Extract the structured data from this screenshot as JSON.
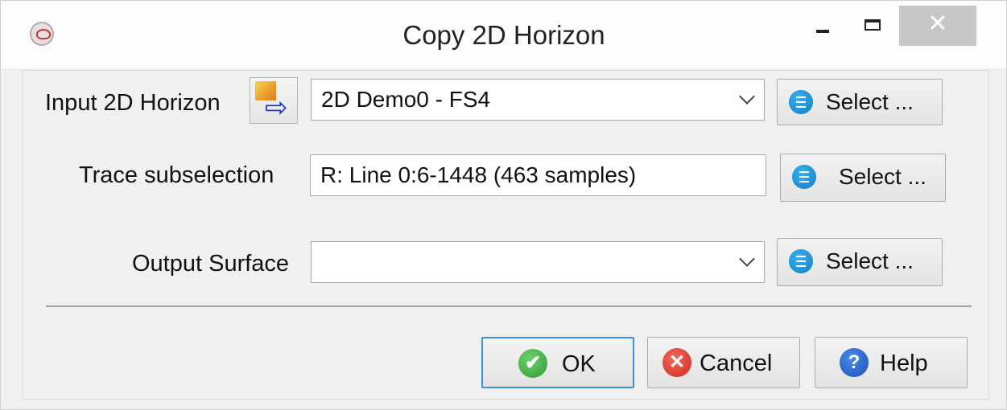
{
  "window": {
    "title": "Copy 2D Horizon",
    "close_glyph": "✕"
  },
  "input_horizon": {
    "label": "Input 2D Horizon",
    "icon": "horizon-import-icon",
    "value": "2D Demo0 - FS4",
    "select_label": "Select ..."
  },
  "trace_subselection": {
    "label": "Trace subselection",
    "value": "R: Line 0:6-1448 (463 samples)",
    "select_label": "Select ..."
  },
  "output_surface": {
    "label": "Output Surface",
    "value": "",
    "select_label": "Select ..."
  },
  "buttons": {
    "ok": "OK",
    "cancel": "Cancel",
    "help": "Help",
    "ok_glyph": "✔",
    "cancel_glyph": "✕",
    "help_glyph": "?"
  },
  "icons": {
    "arrow_glyph": "⇨"
  },
  "colors": {
    "select_icon": "#1a8fd6",
    "ok_icon": "#3aa63f",
    "cancel_icon": "#d9322a",
    "help_icon": "#2a63c9",
    "default_button_border": "#3c90d8"
  }
}
